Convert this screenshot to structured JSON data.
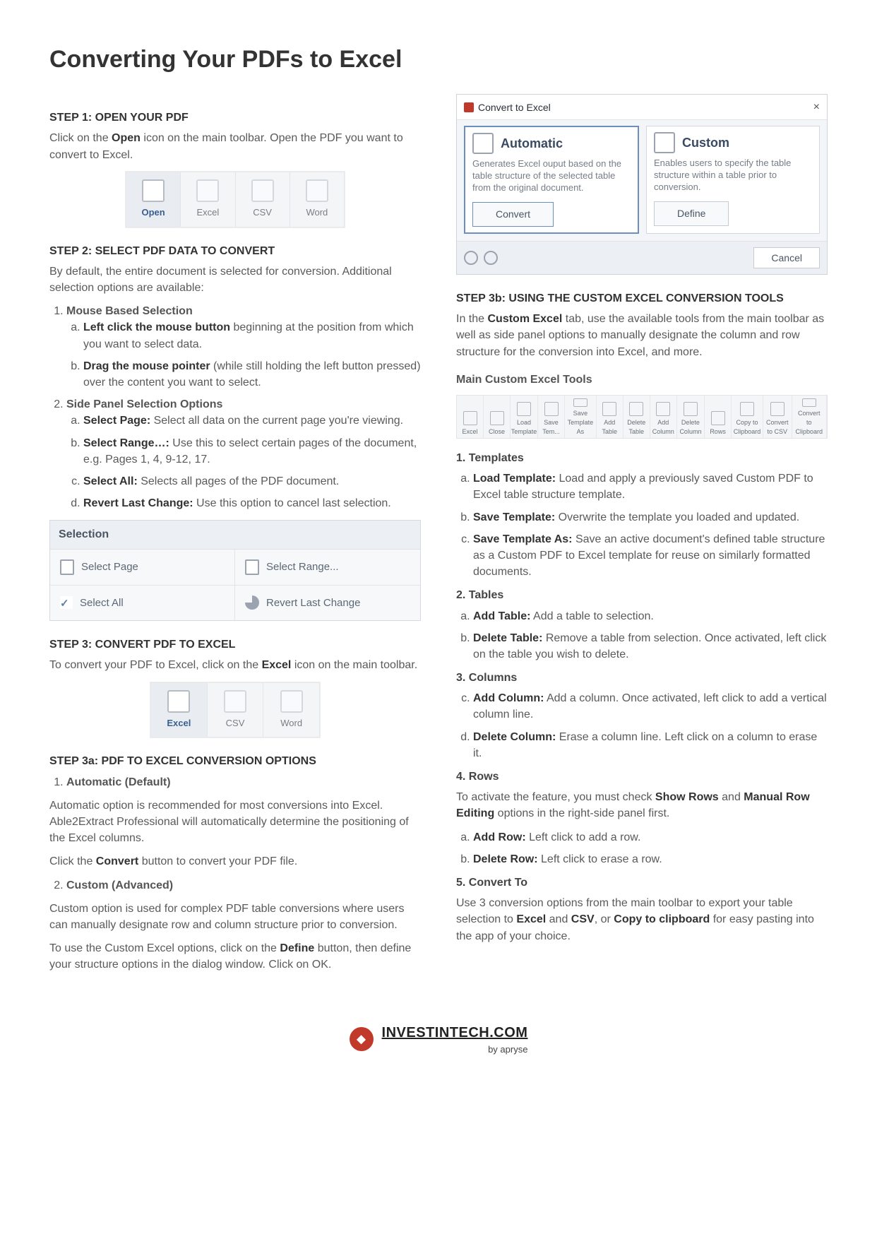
{
  "title": "Converting Your PDFs to Excel",
  "left": {
    "step1": {
      "heading": "STEP 1: OPEN YOUR PDF",
      "text_pre": "Click on the ",
      "text_bold": "Open",
      "text_post": " icon on the main toolbar. Open the PDF you want to convert to Excel.",
      "toolbar": [
        "Open",
        "Excel",
        "CSV",
        "Word"
      ]
    },
    "step2": {
      "heading": "STEP 2: SELECT PDF DATA TO CONVERT",
      "intro": "By default, the entire document is selected for conversion. Additional selection options are available:",
      "item1_head": "Mouse Based Selection",
      "item1_a_b": "Left click the mouse button",
      "item1_a_t": " beginning at the position from which you want to select data.",
      "item1_b_b": "Drag the mouse pointer",
      "item1_b_t": " (while still holding the left button pressed) over the content you want to select.",
      "item2_head": "Side Panel Selection Options",
      "item2_a_b": "Select Page:",
      "item2_a_t": " Select all data on the current page you're viewing.",
      "item2_b_b": "Select Range…:",
      "item2_b_t": " Use this to select certain pages of the document, e.g. Pages 1, 4, 9-12, 17.",
      "item2_c_b": "Select All:",
      "item2_c_t": " Selects all pages of the PDF document.",
      "item2_d_b": "Revert Last Change:",
      "item2_d_t": " Use this option to cancel last selection.",
      "panel_head": "Selection",
      "panel_cells": [
        "Select Page",
        "Select Range...",
        "Select All",
        "Revert Last Change"
      ]
    },
    "step3": {
      "heading": "STEP 3: CONVERT PDF TO EXCEL",
      "text_pre": "To convert your PDF to Excel, click on the ",
      "text_bold": "Excel",
      "text_post": " icon on the main toolbar.",
      "toolbar": [
        "Excel",
        "CSV",
        "Word"
      ]
    },
    "step3a": {
      "heading": "STEP 3a: PDF TO EXCEL CONVERSION OPTIONS",
      "opt1_head": "Automatic (Default)",
      "opt1_p1": "Automatic option is recommended for most conversions into Excel. Able2Extract Professional will automatically determine the positioning of the Excel columns.",
      "opt1_p2_pre": "Click the ",
      "opt1_p2_b": "Convert",
      "opt1_p2_post": " button to convert your PDF file.",
      "opt2_head": "Custom (Advanced)",
      "opt2_p1": "Custom option is used for complex PDF table conversions where users can manually designate row and column structure prior to conversion.",
      "opt2_p2_pre": "To use the Custom Excel options, click on the ",
      "opt2_p2_b": "Define",
      "opt2_p2_post": " button, then define your structure options in the dialog window.  Click on OK."
    }
  },
  "right": {
    "dialog": {
      "title": "Convert to Excel",
      "auto_title": "Automatic",
      "auto_desc": "Generates Excel ouput based on the table structure of the selected table from the original document.",
      "auto_btn": "Convert",
      "custom_title": "Custom",
      "custom_desc": "Enables users to specify the table structure within a table prior to conversion.",
      "custom_btn": "Define",
      "cancel": "Cancel"
    },
    "step3b": {
      "heading": "STEP 3b: USING THE CUSTOM EXCEL CONVERSION TOOLS",
      "intro_pre": "In the ",
      "intro_b": "Custom Excel",
      "intro_post": " tab, use the available tools from the main toolbar as well as side panel options to manually designate the column and row structure for the conversion into Excel, and more.",
      "subhead": "Main Custom Excel Tools",
      "ribbon": [
        "Excel",
        "Close",
        "Load Template",
        "Save Tem...",
        "Save Template As",
        "",
        "Add Table",
        "Delete Table",
        "",
        "Add Column",
        "Delete Column",
        "",
        "",
        "Rows",
        "",
        "Copy to Clipboard",
        "Convert to CSV",
        "Convert to Clipboard"
      ]
    },
    "sec_templates": {
      "head": "1. Templates",
      "a_b": "Load Template:",
      "a_t": " Load and apply a previously saved Custom PDF to Excel table structure template.",
      "b_b": "Save Template:",
      "b_t": " Overwrite the template you loaded and updated.",
      "c_b": "Save Template As:",
      "c_t": " Save an active document's defined table structure as a Custom PDF to Excel template for reuse on similarly formatted documents."
    },
    "sec_tables": {
      "head": "2. Tables",
      "a_b": "Add Table:",
      "a_t": " Add a table to selection.",
      "b_b": "Delete Table:",
      "b_t": " Remove a table from selection. Once activated, left click on the table you wish to delete."
    },
    "sec_columns": {
      "head": "3. Columns",
      "c_b": "Add Column:",
      "c_t": " Add a column. Once activated, left click to add a vertical column line.",
      "d_b": "Delete Column:",
      "d_t": " Erase a column line. Left click on a column to erase it."
    },
    "sec_rows": {
      "head": "4. Rows",
      "intro_pre": "To activate the feature, you must check ",
      "intro_b1": "Show Rows",
      "intro_mid": " and ",
      "intro_b2": "Manual Row Editing",
      "intro_post": " options in the right-side panel first.",
      "a_b": "Add Row:",
      "a_t": " Left click to add a row.",
      "b_b": "Delete Row:",
      "b_t": " Left click to erase a row."
    },
    "sec_convert": {
      "head": "5. Convert To",
      "p_pre": "Use 3 conversion options from the main toolbar to export your table selection to ",
      "p_b1": "Excel",
      "p_mid1": " and ",
      "p_b2": "CSV",
      "p_mid2": ", or ",
      "p_b3": "Copy to clipboard",
      "p_post": " for easy pasting into the app of your choice."
    }
  },
  "footer": {
    "site": "INVESTINTECH.COM",
    "by": "by apryse"
  }
}
